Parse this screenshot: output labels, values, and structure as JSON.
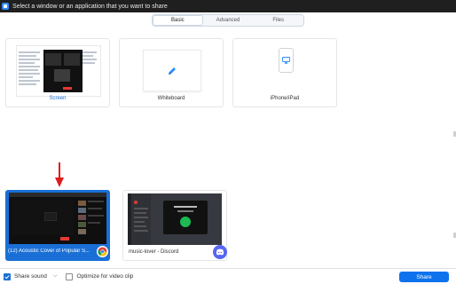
{
  "window": {
    "title": "Select a window or an application that you want to share",
    "icon": "zoom-app-icon"
  },
  "tabs": [
    {
      "label": "Basic",
      "active": true
    },
    {
      "label": "Advanced",
      "active": false
    },
    {
      "label": "Files",
      "active": false
    }
  ],
  "basic_options": {
    "screen": {
      "label": "Screen",
      "selected_color": "#1a6fd6"
    },
    "whiteboard": {
      "label": "Whiteboard",
      "icon": "pencil-icon"
    },
    "iphone_ipad": {
      "label": "iPhone/iPad",
      "icon": "airplay-icon"
    }
  },
  "windows": [
    {
      "label": "(12) Acoustic Cover of Popular S...",
      "app_icon": "chrome-icon",
      "selected": true
    },
    {
      "label": "music-lover - Discord",
      "app_icon": "discord-icon",
      "selected": false
    }
  ],
  "annotation": {
    "icon": "red-arrow-down-icon",
    "color": "#e01b1b"
  },
  "footer": {
    "share_sound": {
      "label": "Share sound",
      "checked": true
    },
    "optimize": {
      "label": "Optimize for video clip",
      "checked": false
    },
    "share_button": "Share"
  },
  "colors": {
    "accent": "#0e72ed",
    "selected_card": "#1a6fd6",
    "titlebar": "#1f1f1f"
  }
}
